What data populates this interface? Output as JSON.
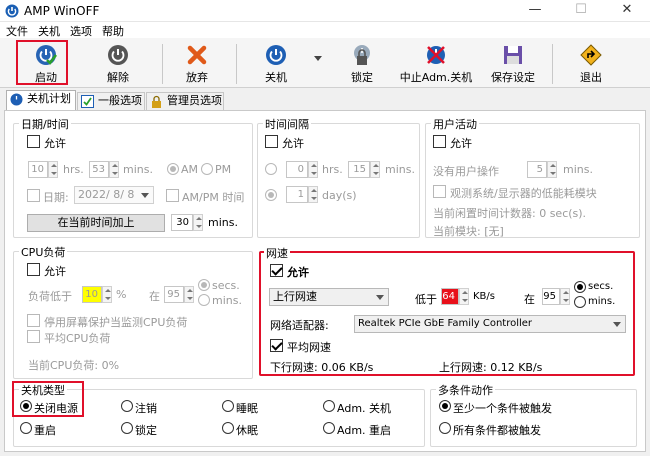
{
  "app": {
    "title": "AMP WinOFF"
  },
  "menu": [
    "文件",
    "关机",
    "选项",
    "帮助"
  ],
  "toolbar": {
    "start": "启动",
    "unlock": "解除",
    "abort": "放弃",
    "shutdown": "关机",
    "lock": "锁定",
    "stop_adm": "中止Adm.关机",
    "save": "保存设定",
    "exit": "退出"
  },
  "tabs": [
    "关机计划",
    "一般选项",
    "管理员选项"
  ],
  "datetime": {
    "legend": "日期/时间",
    "allow": "允许",
    "hrs_val": "10",
    "hrs": "hrs.",
    "mins_val": "53",
    "mins": "mins.",
    "am": "AM",
    "pm": "PM",
    "date_label": "日期:",
    "date_val": "2022/ 8/ 8",
    "ampm": "AM/PM 时间",
    "add_btn": "在当前时间加上",
    "add_val": "30",
    "add_unit": "mins."
  },
  "interval": {
    "legend": "时间间隔",
    "allow": "允许",
    "hrs_val": "0",
    "hrs": "hrs.",
    "mins_val": "15",
    "mins": "mins.",
    "day_val": "1",
    "day": "day(s)"
  },
  "user": {
    "legend": "用户活动",
    "allow": "允许",
    "no_op": "没有用户操作",
    "no_op_val": "5",
    "mins": "mins.",
    "watch": "观测系统/显示器的低能耗模块",
    "idle": "当前闲置时间计数器: 0 sec(s).",
    "module": "当前模块: [无]"
  },
  "cpu": {
    "legend": "CPU负荷",
    "allow": "允许",
    "below": "负荷低于",
    "below_val": "10",
    "pct": "%",
    "at": "在",
    "at_val": "95",
    "secs": "secs.",
    "mins": "mins.",
    "screensaver": "停用屏幕保护当监测CPU负荷",
    "avg": "平均CPU负荷",
    "current": "当前CPU负荷: 0%"
  },
  "net": {
    "legend": "网速",
    "allow": "允许",
    "direction": "上行网速",
    "below": "低于",
    "below_val": "64",
    "unit": "KB/s",
    "at": "在",
    "at_val": "95",
    "secs": "secs.",
    "mins": "mins.",
    "adapter_label": "网络适配器:",
    "adapter": "Realtek PCIe GbE Family Controller",
    "avg": "平均网速",
    "down": "下行网速:  0.06 KB/s",
    "up": "上行网速:  0.12 KB/s"
  },
  "shutdown_type": {
    "legend": "关机类型",
    "options": [
      "关闭电源",
      "注销",
      "睡眠",
      "Adm. 关机",
      "重启",
      "锁定",
      "休眠",
      "Adm. 重启"
    ]
  },
  "multi": {
    "legend": "多条件动作",
    "opt1": "至少一个条件被触发",
    "opt2": "所有条件都被触发"
  },
  "colors": {
    "highlight": "#e0102a",
    "spin_yellow": "#ffff00",
    "spin_red": "#e8101a"
  }
}
